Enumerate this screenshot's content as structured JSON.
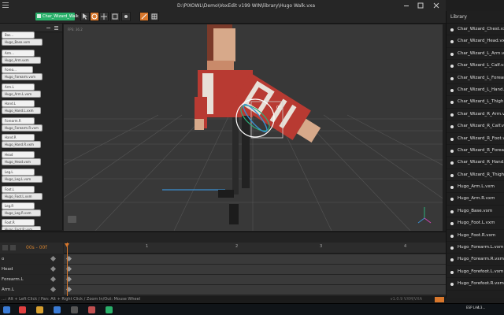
{
  "window": {
    "title": "D:\\PIXOWL\\Demo\\VoxEdit v199 WIN\\library\\Hugo Walk.vxa",
    "active_tab": "Char_Wizard_Walk"
  },
  "viewport": {
    "fps": "FPS: 36.2",
    "gizmo_label": "0°"
  },
  "hierarchy": {
    "nodes": [
      "Bas...",
      "Hugo_Base.vxm",
      "Arm...",
      "Hugo_Arm.vxm",
      "Forea...",
      "Hugo_Forearm.vxm",
      "Arm.L",
      "Hugo_Arm.L.vxm",
      "Hand.L",
      "Hugo_Hand.L.vxm",
      "Forearm.R",
      "Hugo_Forearm.R.vxm",
      "Hand.R",
      "Hugo_Hand.R.vxm",
      "Head",
      "Hugo_Head.vxm",
      "Leg.L",
      "Hugo_Leg.L.vxm",
      "Foot.L",
      "Hugo_Foot.L.vxm",
      "Leg.R",
      "Hugo_Leg.R.vxm",
      "Foot.R",
      "Hugo_Foot.R.vxm"
    ]
  },
  "library": {
    "title": "Library",
    "items": [
      "Char_Wizard_Chest.vxm",
      "Char_Wizard_Head.vxm",
      "Char_Wizard_L_Arm.vxm",
      "Char_Wizard_L_Calf.vxm",
      "Char_Wizard_L_Forearm.vxm",
      "Char_Wizard_L_Hand.vxm",
      "Char_Wizard_L_Thigh.vxm",
      "Char_Wizard_R_Arm.vxm",
      "Char_Wizard_R_Calf.vxm",
      "Char_Wizard_R_Foot.vxm",
      "Char_Wizard_R_Forearm.vxm",
      "Char_Wizard_R_Hand.vxm",
      "Char_Wizard_R_Thigh.vxm",
      "Hugo_Arm.L.vxm",
      "Hugo_Arm.R.vxm",
      "Hugo_Base.vxm",
      "Hugo_Foot.L.vxm",
      "Hugo_Foot.R.vxm",
      "Hugo_Forearm.L.vxm",
      "Hugo_Forearm.R.vxm",
      "Hugo_Forefoot.L.vxm",
      "Hugo_Forefoot.R.vxm"
    ]
  },
  "timeline": {
    "range": "00s - 00f",
    "ticks": [
      "1",
      "2",
      "3",
      "4"
    ],
    "tracks": [
      "o",
      "Head",
      "Forearm.L",
      "Arm.L"
    ]
  },
  "status": {
    "hint": "...: Alt + Left Click / Pan: Alt + Right Click / Zoom In/Out: Mouse Wheel",
    "version": "v1.0.9 VXM/VXA"
  },
  "taskbar": {
    "lang": "ESP LAA",
    "time": "4:3..."
  },
  "colors": {
    "accent_green": "#2ab06a",
    "accent_orange": "#d8772c",
    "viewport_bg": "#383838"
  }
}
